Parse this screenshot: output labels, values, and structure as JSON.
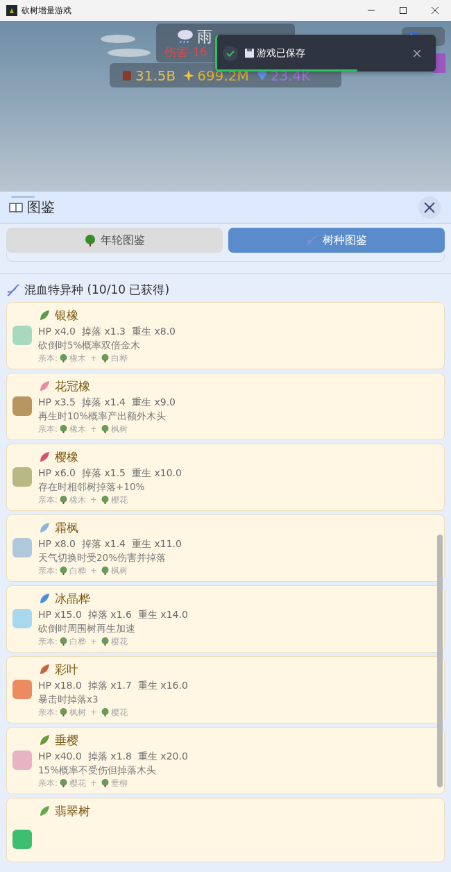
{
  "window": {
    "title": "砍树增量游戏"
  },
  "hud": {
    "weather": "雨",
    "weather_effect": "伤害-16",
    "resources": [
      {
        "kind": "wood",
        "value": "31.5B"
      },
      {
        "kind": "spark",
        "value": "699.2M"
      },
      {
        "kind": "gem",
        "value": "23.4K"
      }
    ]
  },
  "toast": {
    "message": "游戏已保存",
    "level": 0.64
  },
  "panel": {
    "title": "图鉴",
    "tabs": [
      {
        "label": "年轮图鉴",
        "selected": false
      },
      {
        "label": "树种图鉴",
        "selected": true
      }
    ],
    "section_title": "混血特异种 (10/10 已获得)",
    "cards": [
      {
        "name": "银橡",
        "color": "#a8d8c0",
        "stats": [
          "HP x4.0",
          "掉落 x1.3",
          "重生 x8.0"
        ],
        "description": "砍倒时5%概率双倍金木",
        "parents": {
          "label": "亲本:",
          "items": [
            "橡木",
            "白桦"
          ],
          "joiner": "+"
        }
      },
      {
        "name": "花冠橡",
        "color": "#b89660",
        "stats": [
          "HP x3.5",
          "掉落 x1.4",
          "重生 x9.0"
        ],
        "description": "再生时10%概率产出额外木头",
        "parents": {
          "label": "亲本:",
          "items": [
            "橡木",
            "枫树"
          ],
          "joiner": "+"
        }
      },
      {
        "name": "樱橡",
        "color": "#b8b884",
        "stats": [
          "HP x6.0",
          "掉落 x1.5",
          "重生 x10.0"
        ],
        "description": "存在时相邻树掉落+10%",
        "parents": {
          "label": "亲本:",
          "items": [
            "橡木",
            "樱花"
          ],
          "joiner": "+"
        }
      },
      {
        "name": "霜枫",
        "color": "#b0c8dc",
        "stats": [
          "HP x8.0",
          "掉落 x1.4",
          "重生 x11.0"
        ],
        "description": "天气切换时受20%伤害并掉落",
        "parents": {
          "label": "亲本:",
          "items": [
            "白桦",
            "枫树"
          ],
          "joiner": "+"
        }
      },
      {
        "name": "冰晶桦",
        "color": "#a8d8f0",
        "stats": [
          "HP x15.0",
          "掉落 x1.6",
          "重生 x14.0"
        ],
        "description": "砍倒时周围树再生加速",
        "parents": {
          "label": "亲本:",
          "items": [
            "白桦",
            "樱花"
          ],
          "joiner": "+"
        }
      },
      {
        "name": "彩叶",
        "color": "#ec8a60",
        "stats": [
          "HP x18.0",
          "掉落 x1.7",
          "重生 x16.0"
        ],
        "description": "暴击时掉落x3",
        "parents": {
          "label": "亲本:",
          "items": [
            "枫树",
            "樱花"
          ],
          "joiner": "+"
        }
      },
      {
        "name": "垂樱",
        "color": "#e8b4c4",
        "stats": [
          "HP x40.0",
          "掉落 x1.8",
          "重生 x20.0"
        ],
        "description": "15%概率不受伤但掉落木头",
        "parents": {
          "label": "亲本:",
          "items": [
            "樱花",
            "垂柳"
          ],
          "joiner": "+"
        }
      },
      {
        "name": "翡翠树",
        "color": "#3cc070"
      }
    ]
  }
}
